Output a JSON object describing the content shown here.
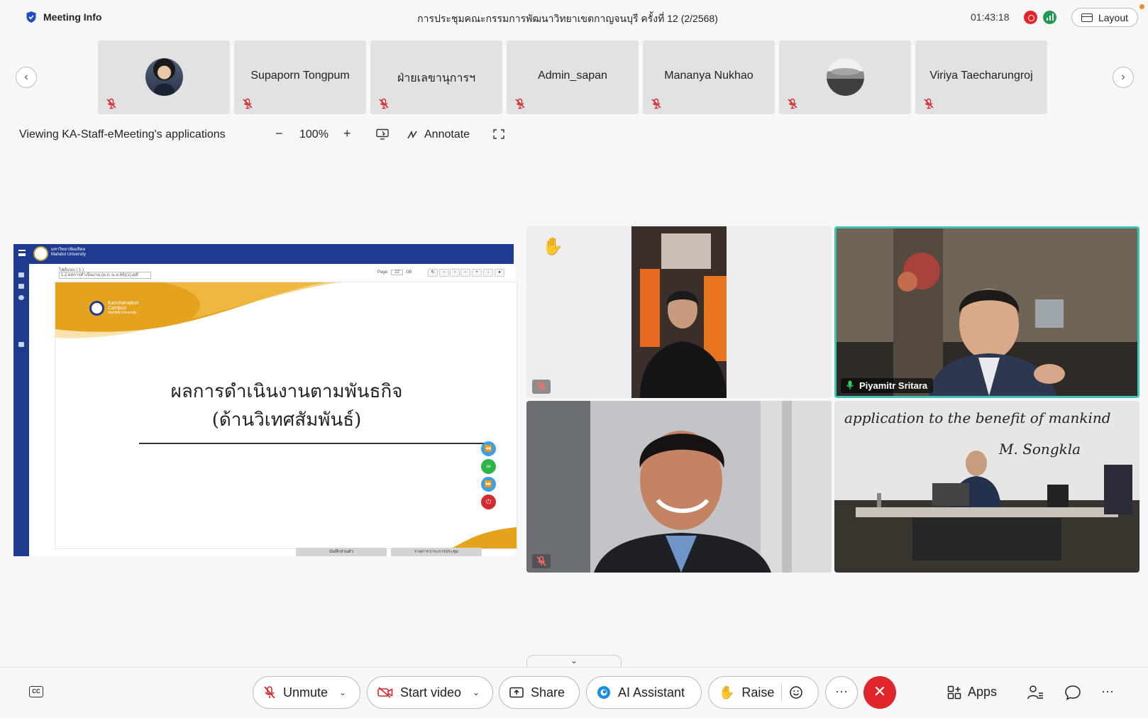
{
  "header": {
    "meeting_info_label": "Meeting Info",
    "meeting_title": "การประชุมคณะกรรมการพัฒนาวิทยาเขตกาญจนบุรี ครั้งที่ 12 (2/2568)",
    "elapsed_time": "01:43:18",
    "layout_label": "Layout"
  },
  "participants_strip": {
    "tiles": [
      {
        "name": "",
        "has_avatar": true
      },
      {
        "name": "Supaporn Tongpum"
      },
      {
        "name": "ฝ่ายเลขานุการฯ"
      },
      {
        "name": "Admin_sapan"
      },
      {
        "name": "Mananya Nukhao"
      },
      {
        "name": "",
        "has_avatar": true
      },
      {
        "name": "Viriya Taecharungroj"
      }
    ]
  },
  "share_toolbar": {
    "viewing_label": "Viewing KA-Staff-eMeeting's applications",
    "zoom_level": "100%",
    "zoom_out": "−",
    "zoom_in": "+",
    "annotate_label": "Annotate"
  },
  "shared_screen": {
    "univ_name_th": "มหาวิทยาลัยมหิดล",
    "univ_name_en": "Mahidol University",
    "file_label": "ไฟล์แนบ ( 1 )",
    "file_dropdown": "1.2 ผลการดำเนินงาน (ม.ก.-ม.ย.68)(1).pdf",
    "page_label": "Page:",
    "page_current": "22",
    "page_total": "/38",
    "campus_line1": "Kanchanaburi",
    "campus_line2": "Campus",
    "campus_line3": "Mahidol University",
    "slide_title_line1": "ผลการดำเนินงานตามพันธกิจ",
    "slide_title_line2": "(ด้านวิเทศสัมพันธ์)",
    "footer_left": "บันทึกส่วนตัว",
    "footer_right": "รายการวาระการประชุม"
  },
  "videos": [
    {
      "name": "",
      "muted": true,
      "raised_hand": true
    },
    {
      "name": "Piyamitr Sritara",
      "muted": false,
      "active_speaker": true
    },
    {
      "name": "",
      "muted": true
    },
    {
      "name": "",
      "muted": false,
      "board_text_1": "application to the benefit of mankind",
      "board_text_2": "M. Songkla"
    }
  ],
  "bottom_bar": {
    "unmute": "Unmute",
    "start_video": "Start video",
    "share": "Share",
    "ai_assistant": "AI Assistant",
    "raise": "Raise",
    "more": "···",
    "apps": "Apps",
    "overflow": "···"
  },
  "colors": {
    "accent_red": "#e0252b",
    "active_speaker_border": "#3ec3b8",
    "record_red": "#e5242a",
    "stats_green": "#1e9b4f",
    "mahidol_blue": "#1e3b8f",
    "slide_gold": "#e4a21d"
  }
}
